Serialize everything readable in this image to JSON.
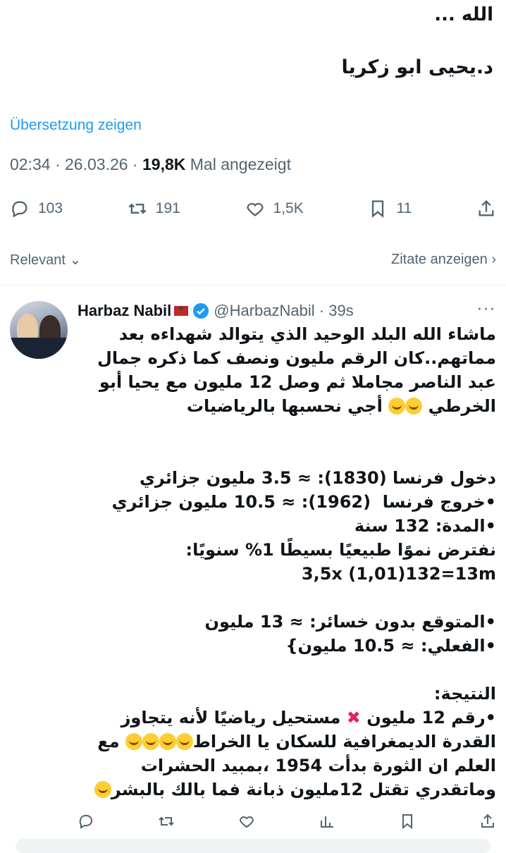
{
  "tweet": {
    "line1": "الله ...",
    "line2": "د.يحيى ابو زكريا",
    "translate_label": "Übersetzung zeigen",
    "time": "02:34",
    "date": "26.03.26",
    "views_count": "19,8K",
    "views_label": "Mal angezeigt",
    "replies": "103",
    "reposts": "191",
    "likes": "1,5K",
    "bookmarks": "11"
  },
  "sort": {
    "label": "Relevant",
    "quotes_label": "Zitate anzeigen"
  },
  "reply": {
    "name": "Harbaz Nabil",
    "handle": "@HarbazNabil",
    "time": "39s",
    "para1": "ماشاء الله البلد الوحيد الذي يتوالد شهداءه بعد مماتهم..كان الرقم مليون ونصف كما ذكره جمال عبد الناصر مجاملا ثم وصل 12 مليون مع يحيا أبو الخرطي",
    "para1_tail": "أجي نحسبها بالرياضيات",
    "l1": "دخول فرنسا (1830): ≈ 3.5 مليون جزائري",
    "l2": "•خروج فرنسا  (1962): ≈ 10.5 مليون جزائري",
    "l3": "•المدة: 132 سنة",
    "l4": "نفترض نموًا طبيعيًا بسيطًا 1% سنويًا:",
    "l5": "3,5x (1,01)132=13m",
    "l6": "•المتوقع بدون خسائر: ≈ 13 مليون",
    "l7": "•الفعلي: ≈ 10.5 مليون}",
    "l8": "النتيجة:",
    "l9a": "•رقم 12 مليون",
    "l9b": "مستحيل رياضيًا لأنه يتجاوز القدرة الديمغرافية للسكان يا الخراط",
    "l9c": "مع العلم ان الثورة بدأت 1954 ،بمبيد الحشرات وماتقدري تقتل 12مليون ذبانة فما بالك بالبشر"
  }
}
